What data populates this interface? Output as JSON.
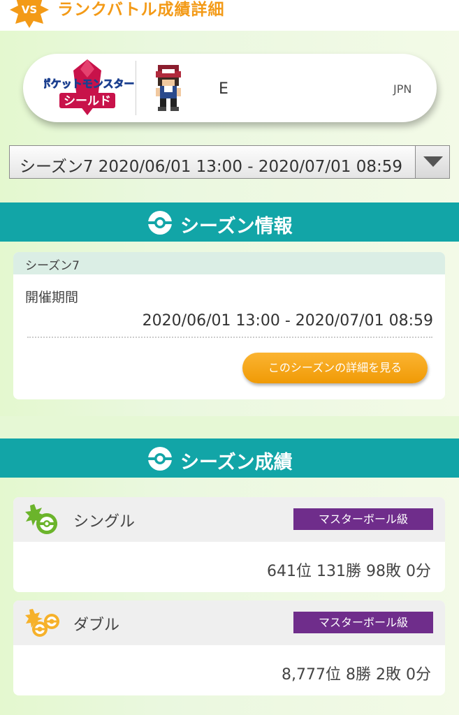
{
  "header": {
    "badge": "VS",
    "title": "ランクバトル成績詳細",
    "accent": "#f39a17"
  },
  "profile": {
    "game": "ポケットモンスター シールド",
    "game_line1": "ポケットモンスター",
    "game_line2": "シールド",
    "name": "E",
    "region": "JPN"
  },
  "season_select": {
    "selected": "シーズン7 2020/06/01 13:00 - 2020/07/01 08:59"
  },
  "season_info": {
    "section_title": "シーズン情報",
    "season_name": "シーズン7",
    "period_label": "開催期間",
    "period_value": "2020/06/01 13:00 - 2020/07/01 08:59",
    "detail_button": "このシーズンの詳細を見る"
  },
  "results": {
    "section_title": "シーズン成績",
    "records": [
      {
        "name": "シングル",
        "rank_class": "マスターボール級",
        "summary": "641位 131勝 98敗 0分"
      },
      {
        "name": "ダブル",
        "rank_class": "マスターボール級",
        "summary": "8,777位 8勝 2敗 0分"
      }
    ]
  },
  "colors": {
    "teal": "#12a5a7",
    "orange": "#f39a17",
    "purple": "#6f2d8b",
    "single_green": "#6bb42b",
    "double_orange": "#f6b12a"
  }
}
